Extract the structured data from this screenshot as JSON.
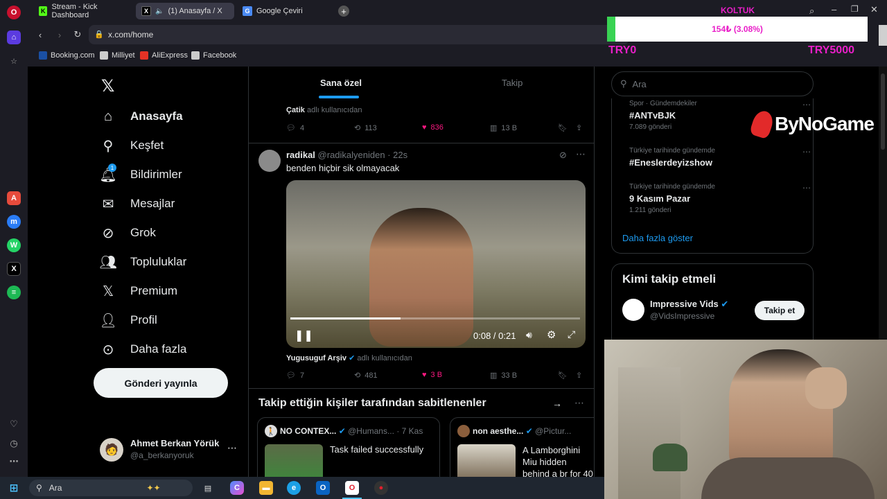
{
  "browser": {
    "tabs": [
      {
        "title": "Stream - Kick Dashboard",
        "icon": "kick-icon"
      },
      {
        "title": "(1) Anasayfa / X",
        "icon": "x-icon"
      },
      {
        "title": "Google Çeviri",
        "icon": "google-translate-icon"
      }
    ],
    "url": "x.com/home",
    "bookmarks": [
      {
        "label": "Booking.com",
        "color": "#1a4fa3"
      },
      {
        "label": "Milliyet",
        "color": "#cccccc"
      },
      {
        "label": "AliExpress",
        "color": "#e43225"
      },
      {
        "label": "Facebook",
        "color": "#cccccc"
      }
    ]
  },
  "overlay": {
    "title": "KOLTUK",
    "progress_text": "154₺ (3.08%)",
    "progress_fraction": 0.0308,
    "min_label": "TRY0",
    "max_label": "TRY5000",
    "logo_text": "ByNoGame",
    "accent": "#39d353",
    "label_color": "#e91ec8"
  },
  "nav": {
    "items": [
      {
        "label": "Anasayfa",
        "icon": "home-icon",
        "bold": true
      },
      {
        "label": "Keşfet",
        "icon": "search-icon"
      },
      {
        "label": "Bildirimler",
        "icon": "bell-icon",
        "badge": "1"
      },
      {
        "label": "Mesajlar",
        "icon": "mail-icon"
      },
      {
        "label": "Grok",
        "icon": "grok-icon"
      },
      {
        "label": "Topluluklar",
        "icon": "communities-icon"
      },
      {
        "label": "Premium",
        "icon": "x-icon"
      },
      {
        "label": "Profil",
        "icon": "person-icon"
      },
      {
        "label": "Daha fazla",
        "icon": "more-circle-icon"
      }
    ],
    "post_button": "Gönderi yayınla",
    "account_name": "Ahmet Berkan Yörük",
    "account_handle": "@a_berkanyoruk"
  },
  "feed": {
    "tabs": [
      "Sana özel",
      "Takip"
    ],
    "tweet1": {
      "repost_by_name": "Çatik",
      "repost_by_suffix": "adlı kullanıcıdan",
      "replies": "4",
      "reposts": "113",
      "likes": "836",
      "views": "13 B"
    },
    "tweet2": {
      "name": "radikal",
      "handle": "@radikalyeniden",
      "time": "· 22s",
      "text": "benden hiçbir sik olmayacak",
      "video_time": "0:08 / 0:21",
      "video_progress": 0.381,
      "repost_by_name": "Yugusuguf Arşiv",
      "repost_by_suffix": "adlı kullanıcıdan",
      "replies": "7",
      "reposts": "481",
      "likes": "3 B",
      "views": "33 B"
    },
    "pinned_header": "Takip ettiğin kişiler tarafından sabitlenenler",
    "pinned": [
      {
        "name": "NO CONTEX...",
        "handle": "@Humans...",
        "time": "· 7 Kas",
        "text": "Task failed successfully"
      },
      {
        "name": "non aesthe...",
        "handle": "@Pictur...",
        "text": "A Lamborghini Miu hidden behind a br for 40 years has be"
      }
    ]
  },
  "right": {
    "search_placeholder": "Ara",
    "trends": [
      {
        "category": "Spor · Gündemdekiler",
        "name": "#ANTvBJK",
        "count": "7.089 gönderi"
      },
      {
        "category": "Türkiye tarihinde gündemde",
        "name": "#Eneslerdeyizshow",
        "count": ""
      },
      {
        "category": "Türkiye tarihinde gündemde",
        "name": "9 Kasım Pazar",
        "count": "1.211 gönderi"
      }
    ],
    "show_more": "Daha fazla göster",
    "who_to_follow": "Kimi takip etmeli",
    "suggest_name": "Impressive Vids",
    "suggest_handle": "@VidsImpressive",
    "follow_button": "Takip et"
  },
  "taskbar": {
    "search_label": "Ara"
  },
  "colors": {
    "x_blue": "#1d9bf0",
    "like_pink": "#f91880",
    "muted": "#71767b",
    "border": "#2f3336"
  }
}
